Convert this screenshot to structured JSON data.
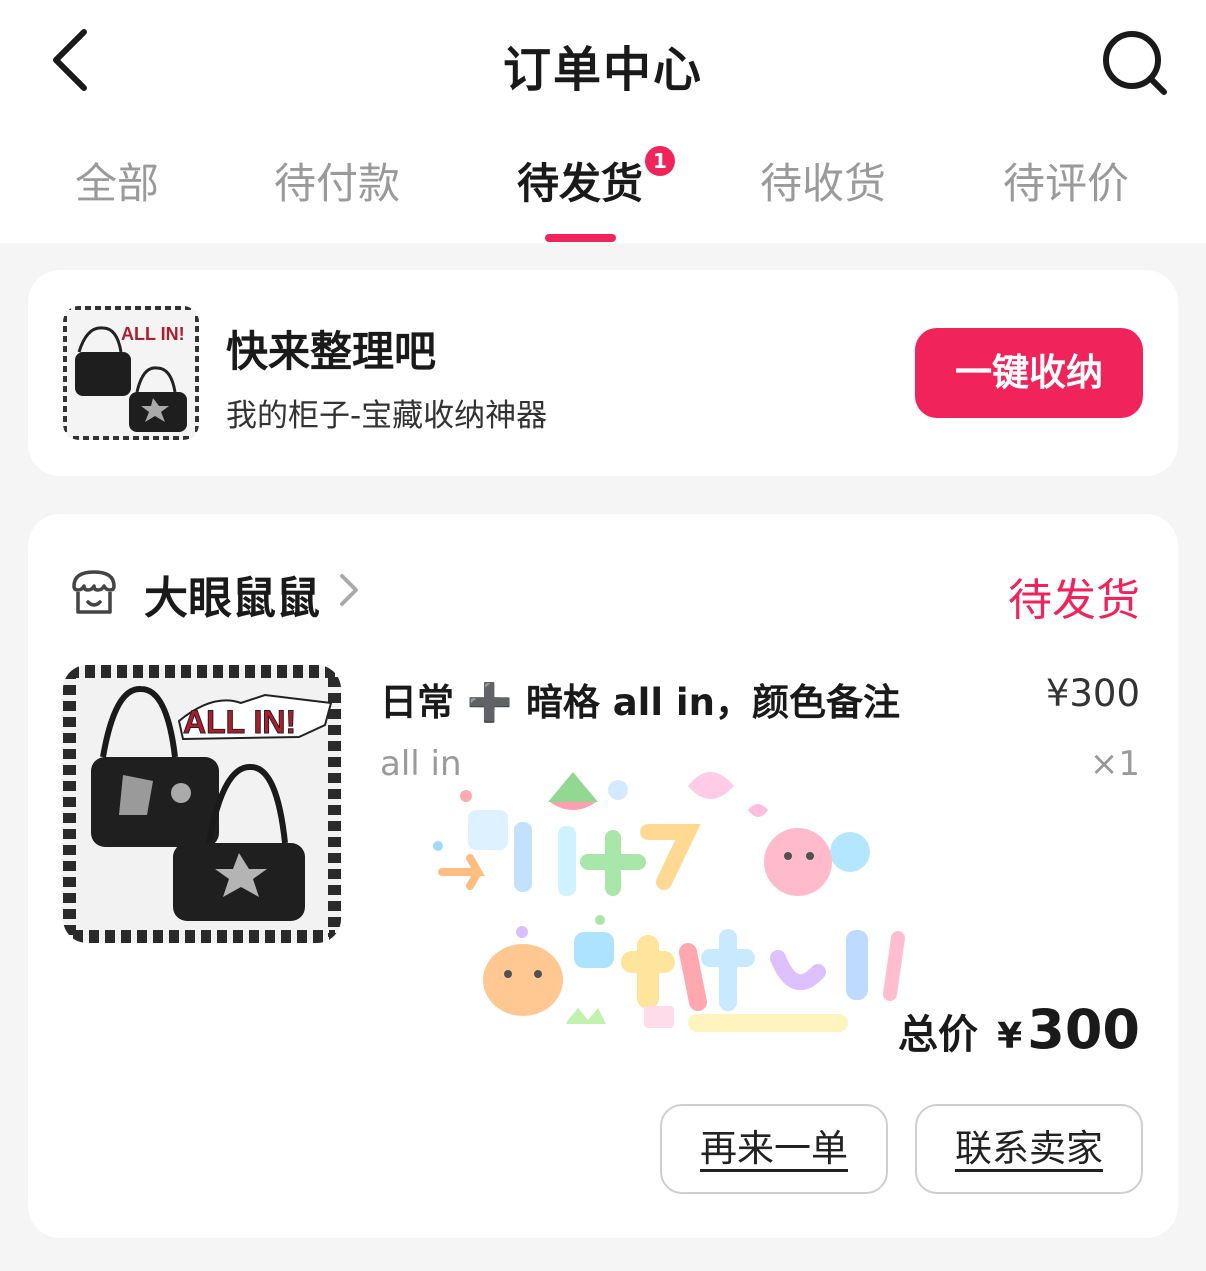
{
  "header": {
    "title": "订单中心",
    "back_icon": "chevron-left-icon",
    "search_icon": "search-icon"
  },
  "tabs": [
    {
      "label": "全部",
      "active": false
    },
    {
      "label": "待付款",
      "active": false
    },
    {
      "label": "待发货",
      "active": true,
      "badge": "1"
    },
    {
      "label": "待收货",
      "active": false
    },
    {
      "label": "待评价",
      "active": false
    }
  ],
  "promo": {
    "title": "快来整理吧",
    "subtitle": "我的柜子-宝藏收纳神器",
    "button_label": "一键收纳",
    "thumb_text": "ALL IN!"
  },
  "order": {
    "shop_name": "大眼鼠鼠",
    "status": "待发货",
    "product": {
      "title": "日常 ➕ 暗格 all in，颜色备注",
      "price": "¥300",
      "spec": "all in",
      "quantity": "×1",
      "image_text": "ALL IN!"
    },
    "total_label": "总价",
    "total_currency": "¥",
    "total_value": "300",
    "actions": {
      "reorder": "再来一单",
      "contact": "联系卖家"
    }
  },
  "colors": {
    "accent": "#f0245b",
    "background": "#f5f5f5",
    "card": "#ffffff"
  }
}
